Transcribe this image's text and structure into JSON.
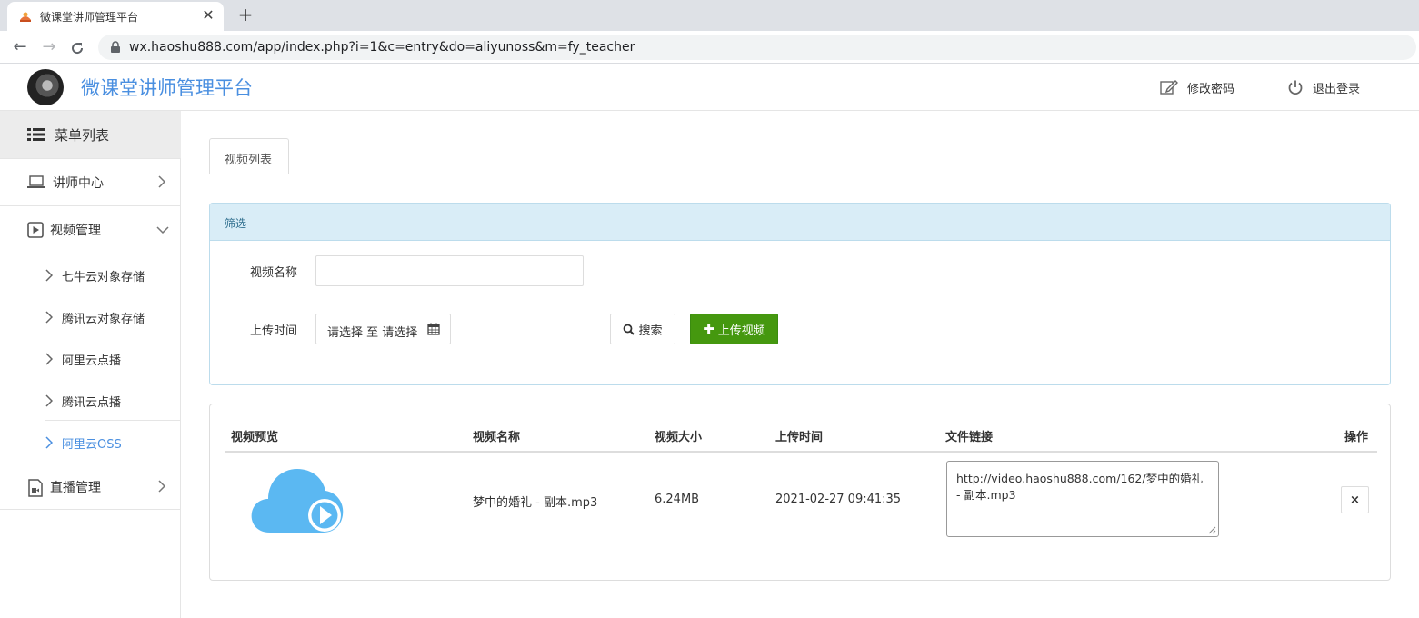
{
  "browser": {
    "tab_title": "微课堂讲师管理平台",
    "url": "wx.haoshu888.com/app/index.php?i=1&c=entry&do=aliyunoss&m=fy_teacher"
  },
  "header": {
    "title": "微课堂讲师管理平台",
    "change_password": "修改密码",
    "logout": "退出登录"
  },
  "sidebar": {
    "menu_title": "菜单列表",
    "items": [
      {
        "label": "讲师中心",
        "icon": "laptop-icon"
      },
      {
        "label": "视频管理",
        "icon": "video-icon"
      },
      {
        "label": "直播管理",
        "icon": "live-icon"
      }
    ],
    "video_sub": [
      "七牛云对象存储",
      "腾讯云对象存储",
      "阿里云点播",
      "腾讯云点播",
      "阿里云OSS"
    ],
    "active_sub": "阿里云OSS"
  },
  "main": {
    "tab": "视频列表",
    "filter": {
      "title": "筛选",
      "name_label": "视频名称",
      "name_value": "",
      "time_label": "上传时间",
      "date_range": "请选择 至 请选择",
      "search": "搜索",
      "upload": "上传视频"
    },
    "table": {
      "headers": [
        "视频预览",
        "视频名称",
        "视频大小",
        "上传时间",
        "文件链接",
        "操作"
      ],
      "rows": [
        {
          "name": "梦中的婚礼 - 副本.mp3",
          "size": "6.24MB",
          "time": "2021-02-27 09:41:35",
          "link": "http://video.haoshu888.com/162/梦中的婚礼 - 副本.mp3",
          "delete": "×"
        }
      ]
    }
  },
  "colors": {
    "accent": "#4a8fe0",
    "upload_green": "#45980f",
    "panel_blue": "#d9edf7",
    "cloud": "#5bb8f2"
  }
}
